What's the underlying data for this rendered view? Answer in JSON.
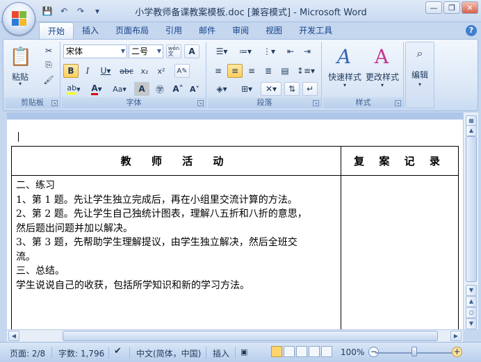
{
  "window": {
    "title": "小学教师备课教案模板.doc [兼容模式] - Microsoft Word",
    "buttons": [
      "minimize",
      "restore",
      "close"
    ]
  },
  "quick_access": [
    "save-icon",
    "undo-icon",
    "redo-icon",
    "customize-icon"
  ],
  "tabs": [
    {
      "label": "开始",
      "active": true
    },
    {
      "label": "插入"
    },
    {
      "label": "页面布局"
    },
    {
      "label": "引用"
    },
    {
      "label": "邮件"
    },
    {
      "label": "审阅"
    },
    {
      "label": "视图"
    },
    {
      "label": "开发工具"
    }
  ],
  "ribbon": {
    "clipboard": {
      "label": "剪贴板",
      "paste": "粘贴"
    },
    "font": {
      "label": "字体",
      "font_name": "宋体",
      "font_size": "二号",
      "wen": "wén\n文",
      "a_box": "A"
    },
    "paragraph": {
      "label": "段落"
    },
    "styles": {
      "label": "样式",
      "quick_styles": "快速样式",
      "change_styles": "更改样式"
    },
    "editing": {
      "label": "编辑"
    }
  },
  "document": {
    "table": {
      "headers": [
        "教 师 活 动",
        "复 案 记 录"
      ],
      "body_lines": [
        "二、练习",
        "1、第 1 题。先让学生独立完成后，再在小组里交流计算的方法。",
        "2、第 2 题。先让学生自己独统计图表，理解八五折和八折的意思，",
        "然后题出问题并加以解决。",
        "3、第 3 题，先帮助学生理解提议，由学生独立解决，然后全班交",
        "流。",
        "三、总结。",
        "学生说说自己的收获，包括所学知识和新的学习方法。"
      ]
    }
  },
  "status": {
    "page": "页面: 2/8",
    "words": "字数: 1,796",
    "language": "中文(简体，中国)",
    "mode": "插入",
    "zoom": "100%",
    "zoom_level": 1.0
  },
  "colors": {
    "ribbon_bg": "#dbe7f6",
    "doc_bg": "#aec6e8",
    "active_highlight": "#ffd46b"
  }
}
